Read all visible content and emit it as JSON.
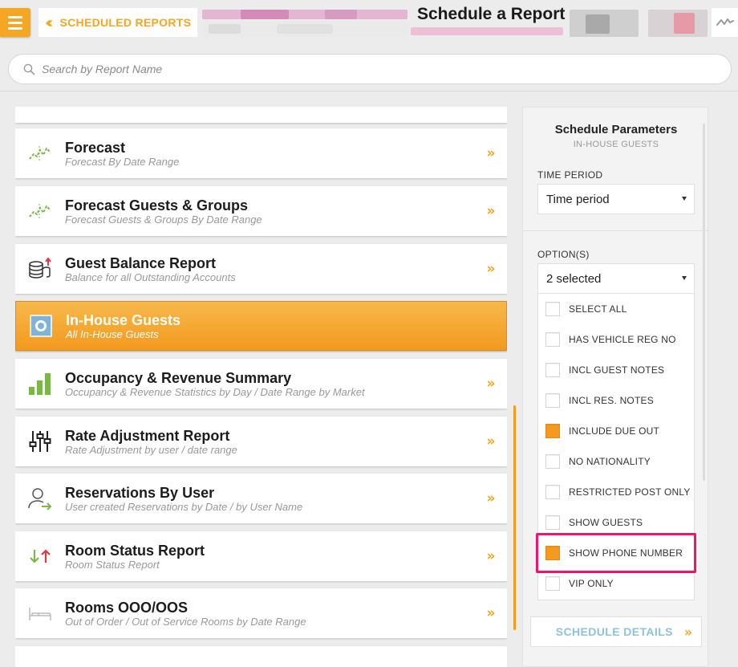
{
  "header": {
    "back_label": "SCHEDULED REPORTS",
    "title": "Schedule a Report"
  },
  "search": {
    "placeholder": "Search by Report Name"
  },
  "reports": [
    {
      "title": "Forecast",
      "subtitle": "Forecast By Date Range",
      "icon": "trend-line-icon"
    },
    {
      "title": "Forecast Guests & Groups",
      "subtitle": "Forecast Guests & Groups By Date Range",
      "icon": "trend-line-icon"
    },
    {
      "title": "Guest Balance Report",
      "subtitle": "Balance for all Outstanding Accounts",
      "icon": "coin-stack-icon"
    },
    {
      "title": "In-House Guests",
      "subtitle": "All In-House Guests",
      "icon": "square-ring-icon",
      "selected": true
    },
    {
      "title": "Occupancy & Revenue Summary",
      "subtitle": "Occupancy & Revenue Statistics by Day / Date Range by Market",
      "icon": "bar-chart-icon"
    },
    {
      "title": "Rate Adjustment Report",
      "subtitle": "Rate Adjustment by user / date range",
      "icon": "sliders-icon"
    },
    {
      "title": "Reservations By User",
      "subtitle": "User created Reservations by Date / by User Name",
      "icon": "user-arrow-icon"
    },
    {
      "title": "Room Status Report",
      "subtitle": "Room Status Report",
      "icon": "up-down-arrows-icon"
    },
    {
      "title": "Rooms OOO/OOS",
      "subtitle": "Out of Order / Out of Service Rooms by Date Range",
      "icon": "bed-icon"
    }
  ],
  "panel": {
    "title": "Schedule Parameters",
    "subtitle": "IN-HOUSE GUESTS",
    "time_period_label": "TIME PERIOD",
    "time_period_value": "Time period",
    "options_label": "OPTION(S)",
    "options_value": "2 selected",
    "options": [
      {
        "label": "SELECT ALL",
        "checked": false
      },
      {
        "label": "HAS VEHICLE REG NO",
        "checked": false
      },
      {
        "label": "INCL GUEST NOTES",
        "checked": false
      },
      {
        "label": "INCL RES. NOTES",
        "checked": false
      },
      {
        "label": "INCLUDE DUE OUT",
        "checked": true
      },
      {
        "label": "NO NATIONALITY",
        "checked": false
      },
      {
        "label": "RESTRICTED POST ONLY",
        "checked": false
      },
      {
        "label": "SHOW GUESTS",
        "checked": false
      },
      {
        "label": "SHOW PHONE NUMBER",
        "checked": true
      },
      {
        "label": "VIP ONLY",
        "checked": false
      }
    ],
    "schedule_button": "SCHEDULE DETAILS"
  },
  "colors": {
    "accent": "#f39a1f",
    "highlight": "#f0146a",
    "link_blue": "#8ec3dd"
  }
}
